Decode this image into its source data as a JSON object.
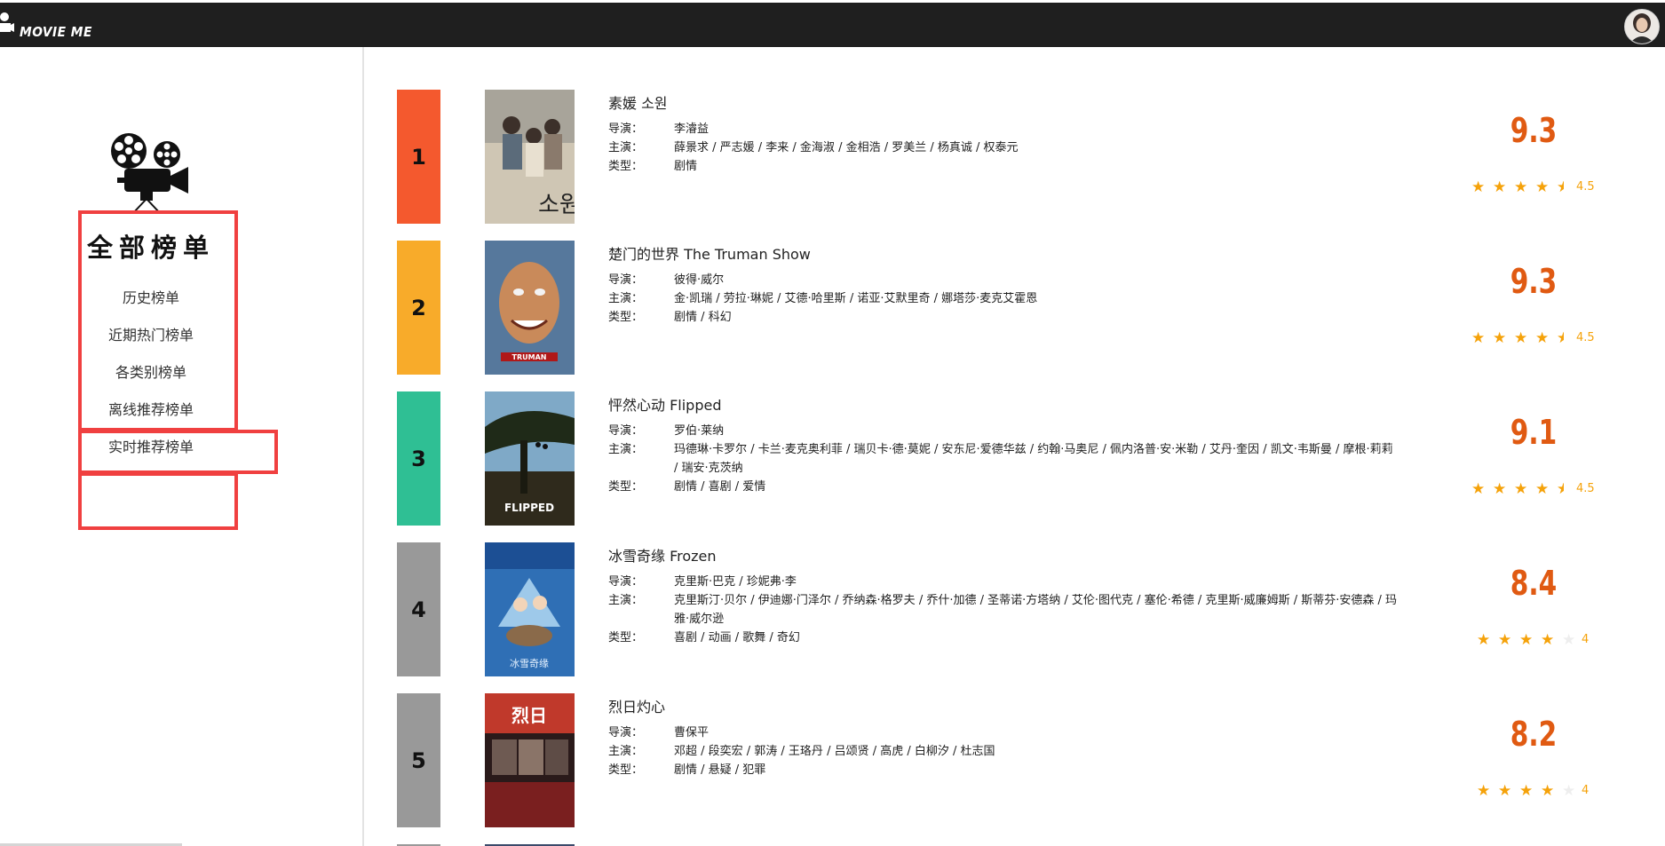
{
  "header": {
    "brand": "MOVIE ME"
  },
  "sidebar": {
    "title": "全部榜单",
    "items": [
      {
        "label": "历史榜单"
      },
      {
        "label": "近期热门榜单"
      },
      {
        "label": "各类别榜单"
      },
      {
        "label": "离线推荐榜单"
      },
      {
        "label": "实时推荐榜单"
      }
    ]
  },
  "labels": {
    "director": "导演：",
    "cast": "主演：",
    "genre": "类型："
  },
  "movies": [
    {
      "rank": "1",
      "rank_color": "#f4592e",
      "title": "素媛 소원",
      "director": "李濬益",
      "cast": "薛景求 / 严志媛 / 李来 / 金海淑 / 金相浩 / 罗美兰 / 杨真诚 / 权泰元",
      "genre": "剧情",
      "score": "9.3",
      "stars": 4.5,
      "rating": "4.5"
    },
    {
      "rank": "2",
      "rank_color": "#f8ab2a",
      "title": "楚门的世界 The Truman Show",
      "director": "彼得·威尔",
      "cast": "金·凯瑞 / 劳拉·琳妮 / 艾德·哈里斯 / 诺亚·艾默里奇 / 娜塔莎·麦克艾霍恩",
      "genre": "剧情 / 科幻",
      "score": "9.3",
      "stars": 4.5,
      "rating": "4.5"
    },
    {
      "rank": "3",
      "rank_color": "#2fbf94",
      "title": "怦然心动 Flipped",
      "director": "罗伯·莱纳",
      "cast": "玛德琳·卡罗尔 / 卡兰·麦克奥利菲 / 瑞贝卡·德·莫妮 / 安东尼·爱德华兹 / 约翰·马奥尼 / 佩内洛普·安·米勒 / 艾丹·奎因 / 凯文·韦斯曼 / 摩根·莉莉 / 瑞安·克茨纳",
      "genre": "剧情 / 喜剧 / 爱情",
      "score": "9.1",
      "stars": 4.5,
      "rating": "4.5"
    },
    {
      "rank": "4",
      "rank_color": "#999999",
      "title": "冰雪奇缘 Frozen",
      "director": "克里斯·巴克 / 珍妮弗·李",
      "cast": "克里斯汀·贝尔 / 伊迪娜·门泽尔 / 乔纳森·格罗夫 / 乔什·加德 / 圣蒂诺·方塔纳 / 艾伦·图代克 / 塞伦·希德 / 克里斯·威廉姆斯 / 斯蒂芬·安德森 / 玛雅·威尔逊",
      "genre": "喜剧 / 动画 / 歌舞 / 奇幻",
      "score": "8.4",
      "stars": 4,
      "rating": "4"
    },
    {
      "rank": "5",
      "rank_color": "#999999",
      "title": "烈日灼心",
      "director": "曹保平",
      "cast": "邓超 / 段奕宏 / 郭涛 / 王珞丹 / 吕颂贤 / 高虎 / 白柳汐 / 杜志国",
      "genre": "剧情 / 悬疑 / 犯罪",
      "score": "8.2",
      "stars": 4,
      "rating": "4"
    }
  ]
}
